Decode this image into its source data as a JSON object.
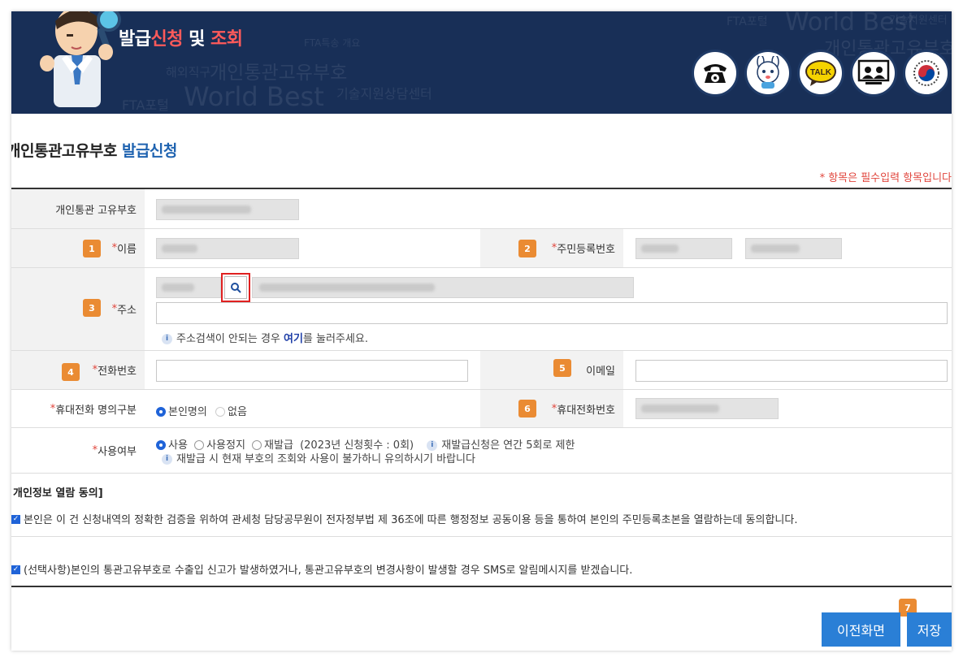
{
  "header": {
    "title_part1": "발급",
    "title_part2": "신청",
    "title_part3": " 및 ",
    "title_part4": "조회",
    "bg_words": [
      "FTA포털",
      "World Best",
      "개인통관고유부호",
      "기술지원상담센터",
      "해외직구",
      "FTA포털",
      "World Best",
      "기술지원센터",
      "FTA특송 개요",
      "개인통관고유부호"
    ],
    "quick_icons": [
      "phone-icon",
      "mascot-icon",
      "talk-icon",
      "remote-support-icon",
      "government-emblem-icon"
    ],
    "talk_label": "TALK"
  },
  "page": {
    "title_part1": "개인통관고유부호",
    "title_part2": " 발급신청",
    "required_note": "* 항목은 필수입력 항목입니다"
  },
  "form": {
    "unique_code_label": "개인통관 고유부호",
    "name_label": "이름",
    "rrn_label": "주민등록번호",
    "address_label": "주소",
    "address_help_1": "주소검색이 안되는 경우 ",
    "address_help_link": "여기",
    "address_help_2": "를 눌러주세요.",
    "phone_label": "전화번호",
    "email_label": "이메일",
    "mobile_owner_label": "휴대전화 명의구분",
    "mobile_owner_opt1": "본인명의",
    "mobile_owner_opt2": "없음",
    "mobile_label": "휴대전화번호",
    "usage_label": "사용여부",
    "usage_opt1": "사용",
    "usage_opt2": "사용정지",
    "usage_opt3": "재발급",
    "usage_count": "(2023년 신청횟수 : 0회)",
    "usage_note1": "재발급신청은 연간 5회로 제한",
    "usage_note2": "재발급 시 현재 부호의 조회와 사용이 불가하니 유의하시기 바랍니다",
    "star": "*"
  },
  "consent": {
    "section_title": "개인정보 열람 동의]",
    "consent1": "본인은 이 건 신청내역의 정확한 검증을 위하여 관세청 담당공무원이 전자정부법 제 36조에 따른 행정정보 공동이용 등을 통하여 본인의 주민등록초본을 열람하는데 동의합니다.",
    "consent2": "(선택사항)본인의 통관고유부호로 수출입 신고가 발생하였거나, 통관고유부호의 변경사항이 발생할 경우 SMS로 알림메시지를 받겠습니다."
  },
  "badges": [
    "1",
    "2",
    "3",
    "4",
    "5",
    "6",
    "7"
  ],
  "buttons": {
    "prev": "이전화면",
    "save": "저장"
  },
  "colors": {
    "banner_bg": "#182f57",
    "accent_red": "#ff5a5a",
    "title_blue": "#1f63b0",
    "badge_orange": "#ea8b33",
    "button_blue": "#2a7fd6",
    "required_red": "#e0453c"
  }
}
